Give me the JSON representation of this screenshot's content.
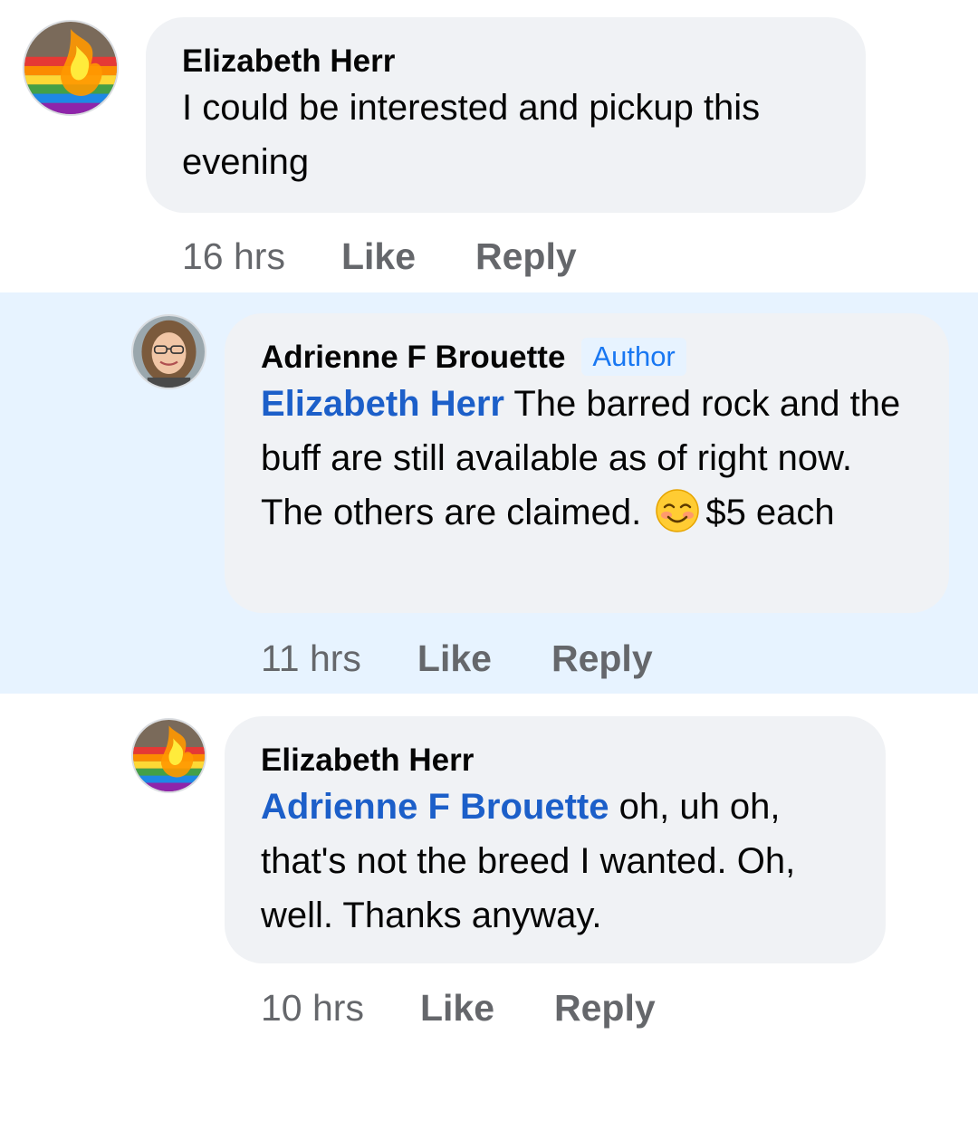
{
  "comments": [
    {
      "author": "Elizabeth Herr",
      "text": "I could be interested and pickup this evening",
      "time": "16 hrs",
      "like_label": "Like",
      "reply_label": "Reply"
    },
    {
      "author": "Adrienne F Brouette",
      "badge": "Author",
      "mention": "Elizabeth Herr",
      "text_before_emoji": " The barred rock and the buff are still available as of right now. The others are claimed.",
      "emoji": "smiling-face-with-blush-emoji",
      "text_after_emoji": "$5 each",
      "time": "11 hrs",
      "like_label": "Like",
      "reply_label": "Reply",
      "highlighted": true
    },
    {
      "author": "Elizabeth Herr",
      "mention": "Adrienne F Brouette",
      "text": " oh, uh oh, that's not the breed I wanted. Oh, well. Thanks anyway.",
      "time": "10 hrs",
      "like_label": "Like",
      "reply_label": "Reply"
    }
  ],
  "colors": {
    "bubble": "#f0f2f5",
    "highlight": "#e7f3ff",
    "mention": "#1c5fc9",
    "badge_text": "#1877f2",
    "meta": "#65676b"
  }
}
